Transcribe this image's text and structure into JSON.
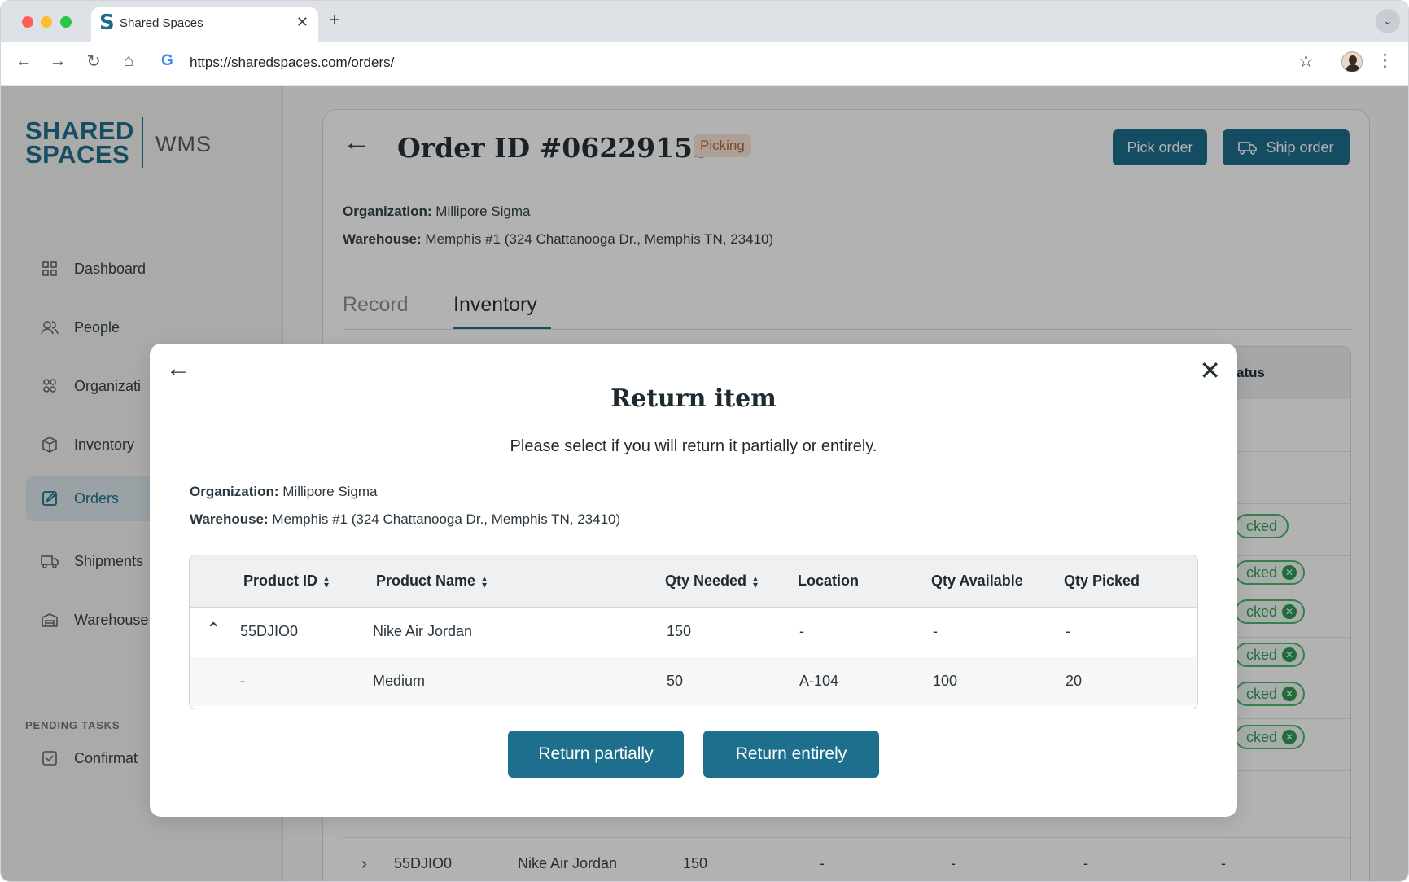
{
  "browser": {
    "tab_title": "Shared Spaces",
    "favicon_letter": "S",
    "url": "https://sharedspaces.com/orders/",
    "new_tab_symbol": "+",
    "google_letter": "G"
  },
  "sidebar": {
    "logo_line1": "SHARED",
    "logo_line2": "SPACES",
    "logo_wms": "WMS",
    "items": [
      {
        "label": "Dashboard",
        "icon": "grid-icon"
      },
      {
        "label": "People",
        "icon": "people-icon"
      },
      {
        "label": "Organizati",
        "icon": "organizations-icon"
      },
      {
        "label": "Inventory",
        "icon": "box-icon"
      },
      {
        "label": "Orders",
        "icon": "edit-icon"
      },
      {
        "label": "Shipments",
        "icon": "truck-icon"
      },
      {
        "label": "Warehouse",
        "icon": "warehouse-icon"
      }
    ],
    "pending_title": "PENDING TASKS",
    "pending_items": [
      {
        "label": "Confirmat",
        "icon": "confirm-icon"
      }
    ]
  },
  "order": {
    "title": "Order ID #06229155",
    "status": "Picking",
    "pick_button": "Pick order",
    "ship_button": "Ship order",
    "organization_label": "Organization:",
    "organization_value": "Millipore Sigma",
    "warehouse_label": "Warehouse:",
    "warehouse_value": "Memphis #1 (324 Chattanooga Dr., Memphis TN, 23410)",
    "tabs": [
      "Record",
      "Inventory"
    ],
    "status_header_partial": "atus",
    "picked_label_partial": "cked",
    "picked_header_label_partial": "cked",
    "bottom_row": {
      "product_id": "55DJIO0",
      "product_name": "Nike Air Jordan",
      "qty_needed": "150",
      "location": "-",
      "qty_available": "-",
      "qty_picked": "-",
      "status": "-"
    }
  },
  "modal": {
    "title": "Return item",
    "subtitle": "Please select if you will return it partially or entirely.",
    "organization_label": "Organization:",
    "organization_value": "Millipore Sigma",
    "warehouse_label": "Warehouse:",
    "warehouse_value": "Memphis #1 (324 Chattanooga Dr., Memphis TN, 23410)",
    "columns": [
      "Product ID",
      "Product Name",
      "Qty Needed",
      "Location",
      "Qty Available",
      "Qty Picked"
    ],
    "rows": [
      {
        "product_id": "55DJIO0",
        "product_name": "Nike Air Jordan",
        "qty_needed": "150",
        "location": "-",
        "qty_available": "-",
        "qty_picked": "-"
      },
      {
        "product_id": "-",
        "product_name": "Medium",
        "qty_needed": "50",
        "location": "A-104",
        "qty_available": "100",
        "qty_picked": "20"
      }
    ],
    "return_partially": "Return partially",
    "return_entirely": "Return entirely"
  },
  "colors": {
    "brand_teal": "#1d6f8d",
    "picked_green": "#2f9c55",
    "picking_badge_bg": "#fbe6d7"
  }
}
